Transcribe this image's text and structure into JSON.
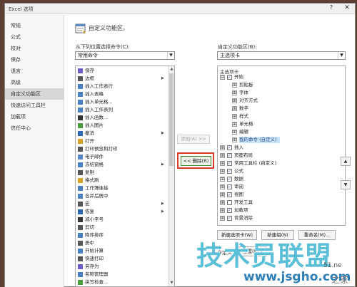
{
  "window": {
    "title": "Excel 选项",
    "help_glyph": "?",
    "close_glyph": "✕"
  },
  "sidebar": {
    "items": [
      {
        "label": "常规"
      },
      {
        "label": "公式"
      },
      {
        "label": "校对"
      },
      {
        "label": "保存"
      },
      {
        "label": "语言"
      },
      {
        "label": "高级"
      },
      {
        "label": "自定义功能区",
        "active": true
      },
      {
        "label": "快速访问工具栏"
      },
      {
        "label": "加载项"
      },
      {
        "label": "信任中心"
      }
    ]
  },
  "main": {
    "heading": "自定义功能区。",
    "left_label": "从下列位置选择命令(C):",
    "left_select_value": "常用命令",
    "right_label": "自定义功能区(B):",
    "right_select_value": "主选项卡",
    "commands": [
      {
        "label": "保存",
        "icon": "save-icon",
        "color": "#6b5cc7"
      },
      {
        "label": "边框",
        "icon": "border-icon",
        "color": "#555555",
        "sub": true
      },
      {
        "label": "插入工作表行",
        "icon": "insert-row-icon",
        "color": "#4a7fc0"
      },
      {
        "label": "插入表格",
        "icon": "table-icon",
        "color": "#4a7fc0"
      },
      {
        "label": "插入单元格...",
        "icon": "insert-cell-icon",
        "color": "#4a7fc0"
      },
      {
        "label": "插入工作表列",
        "icon": "insert-col-icon",
        "color": "#4a7fc0"
      },
      {
        "label": "插入函数...",
        "icon": "function-icon",
        "color": "#333333"
      },
      {
        "label": "插入图片",
        "icon": "picture-icon",
        "color": "#4a9a3e"
      },
      {
        "label": "撤消",
        "icon": "undo-icon",
        "color": "#2d64b3",
        "sub": true
      },
      {
        "label": "打开",
        "icon": "open-icon",
        "color": "#d9a22b"
      },
      {
        "label": "打印预览和打印",
        "icon": "print-icon",
        "color": "#555555"
      },
      {
        "label": "电子邮件",
        "icon": "email-icon",
        "color": "#5a86c8"
      },
      {
        "label": "冻结窗格",
        "icon": "freeze-icon",
        "color": "#4a7fc0",
        "sub": true
      },
      {
        "label": "复制",
        "icon": "copy-icon",
        "color": "#555555"
      },
      {
        "label": "格式刷",
        "icon": "format-painter-icon",
        "color": "#d9a22b"
      },
      {
        "label": "工作簿连接",
        "icon": "connection-icon",
        "color": "#4a7fc0"
      },
      {
        "label": "合并后居中",
        "icon": "merge-icon",
        "color": "#4a7fc0"
      },
      {
        "label": "宏",
        "icon": "macro-icon",
        "color": "#555555",
        "sub": true
      },
      {
        "label": "恢复",
        "icon": "redo-icon",
        "color": "#2d64b3",
        "sub": true
      },
      {
        "label": "减小字号",
        "icon": "font-smaller-icon",
        "color": "#333333"
      },
      {
        "label": "剪切",
        "icon": "cut-icon",
        "color": "#555555"
      },
      {
        "label": "降序排序",
        "icon": "sort-desc-icon",
        "color": "#4a7fc0"
      },
      {
        "label": "居中",
        "icon": "center-icon",
        "color": "#555555"
      },
      {
        "label": "开始计算",
        "icon": "calculate-icon",
        "color": "#4a7fc0"
      },
      {
        "label": "快速打印",
        "icon": "quick-print-icon",
        "color": "#555555"
      },
      {
        "label": "另存为",
        "icon": "save-as-icon",
        "color": "#6b5cc7"
      },
      {
        "label": "名称管理器",
        "icon": "name-manager-icon",
        "color": "#4a7fc0"
      },
      {
        "label": "拼写检查...",
        "icon": "spelling-icon",
        "color": "#4a9a3e"
      }
    ],
    "add_label": "添加(A) >>",
    "remove_label": "<< 删除(R)",
    "tree_header": "主选项卡",
    "tree": [
      {
        "label": "开始",
        "level": 0,
        "expander": "⊟",
        "check": true
      },
      {
        "label": "剪贴板",
        "level": 1,
        "expander": "⊞"
      },
      {
        "label": "字体",
        "level": 1,
        "expander": "⊞"
      },
      {
        "label": "对齐方式",
        "level": 1,
        "expander": "⊞"
      },
      {
        "label": "数字",
        "level": 1,
        "expander": "⊞"
      },
      {
        "label": "样式",
        "level": 1,
        "expander": "⊞"
      },
      {
        "label": "单元格",
        "level": 1,
        "expander": "⊞"
      },
      {
        "label": "编辑",
        "level": 1,
        "expander": "⊞"
      },
      {
        "label": "我的命令 (自定义)",
        "level": 1,
        "expander": "⊞",
        "selected": true
      },
      {
        "label": "插入",
        "level": 0,
        "expander": "⊞",
        "check": true
      },
      {
        "label": "页面布局",
        "level": 0,
        "expander": "⊞",
        "check": true
      },
      {
        "label": "常用工具栏 (自定义)",
        "level": 0,
        "expander": "⊞",
        "check": true
      },
      {
        "label": "公式",
        "level": 0,
        "expander": "⊞",
        "check": true
      },
      {
        "label": "数据",
        "level": 0,
        "expander": "⊞",
        "check": true
      },
      {
        "label": "审阅",
        "level": 0,
        "expander": "⊞",
        "check": true
      },
      {
        "label": "视图",
        "level": 0,
        "expander": "⊞",
        "check": true
      },
      {
        "label": "开发工具",
        "level": 0,
        "expander": "⊞",
        "check": false
      },
      {
        "label": "加载项",
        "level": 0,
        "expander": "⊞",
        "check": true
      },
      {
        "label": "背景消除",
        "level": 0,
        "expander": "⊞",
        "check": true
      }
    ],
    "new_tab_label": "新建选项卡(W)",
    "new_group_label": "新建组(N)",
    "rename_label": "重命名(M)...",
    "customize_label": "自定义:",
    "reset_label": "重置(E)",
    "move_up_glyph": "▲",
    "move_down_glyph": "▼"
  },
  "watermark": {
    "main": "技术员联盟",
    "url": "www.jsgho.com",
    "side": "51.ne",
    "side2": "之家"
  },
  "colors": {
    "sidebar_active": "#d7d7d7",
    "remove_highlight": "#d63b2c",
    "tree_selected": "#cce4f7",
    "watermark": "#5bbfd7"
  }
}
